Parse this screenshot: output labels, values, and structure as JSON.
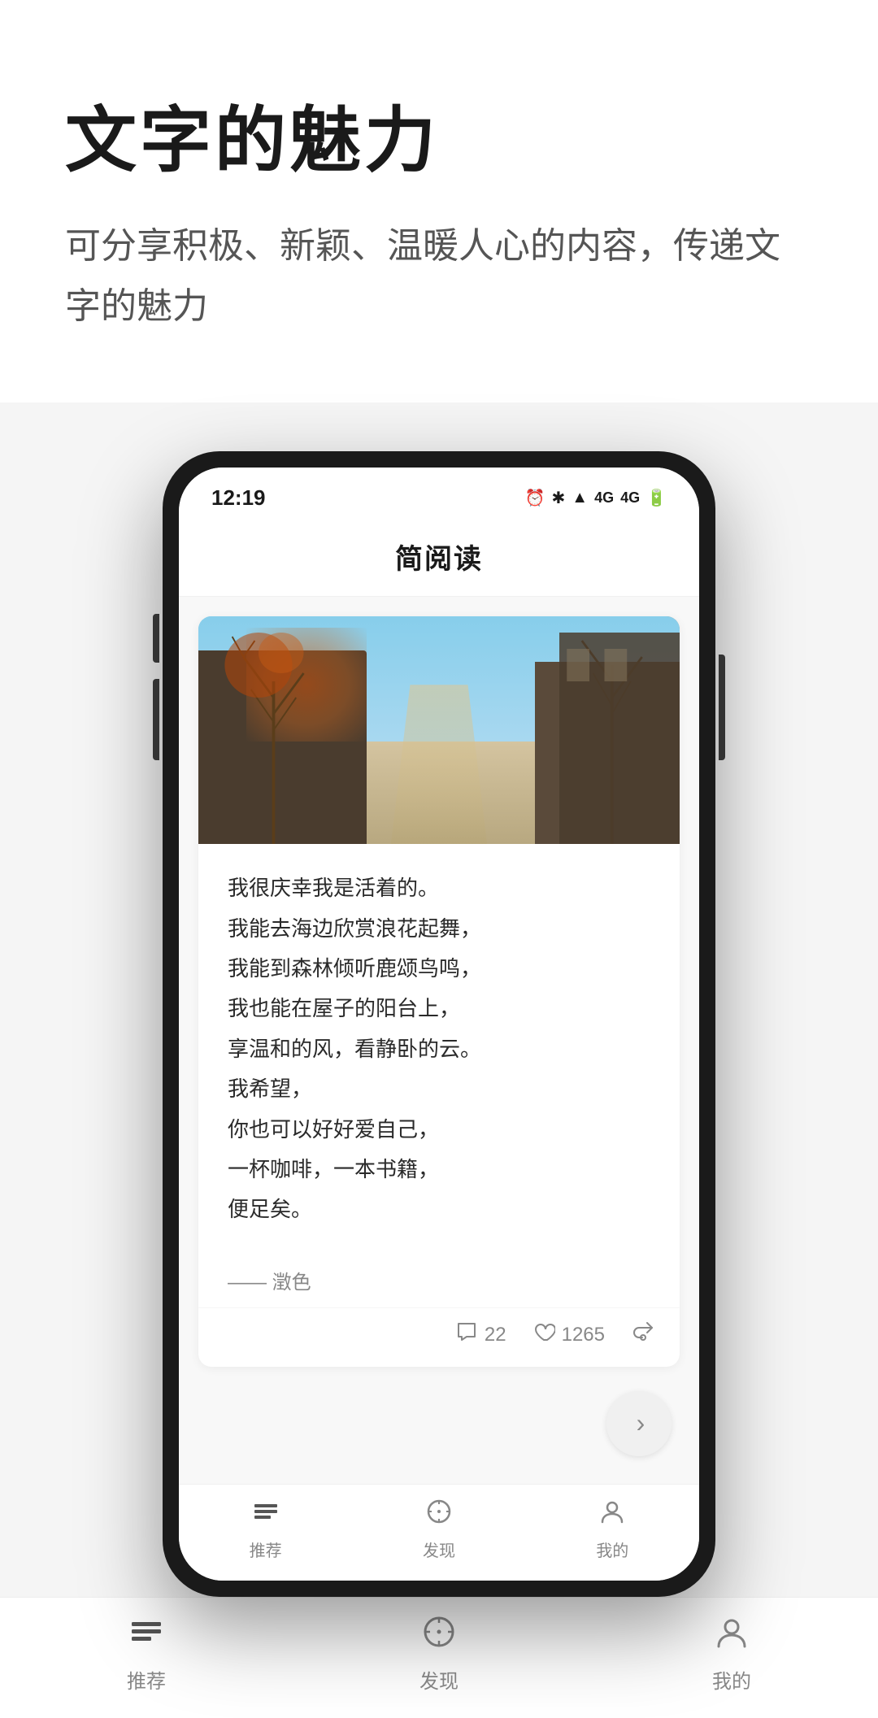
{
  "page": {
    "background": "#f5f5f5"
  },
  "header": {
    "title": "文字的魅力",
    "subtitle": "可分享积极、新颖、温暖人心的内容，传递文字的魅力"
  },
  "phone": {
    "status_bar": {
      "time": "12:19",
      "network_icon": "N",
      "icons": "⏰ ✱ ⚡ ▲ 4G 4G 🔋"
    },
    "app_title": "简阅读",
    "article": {
      "text_lines": [
        "我很庆幸我是活着的。",
        "我能去海边欣赏浪花起舞，",
        "我能到森林倾听鹿颂鸟鸣，",
        "我也能在屋子的阳台上，",
        "享温和的风，看静卧的云。",
        "我希望，",
        "你也可以好好爱自己，",
        "一杯咖啡，一本书籍，",
        "便足矣。"
      ],
      "author": "—— 澂色",
      "comment_icon": "💬",
      "comment_count": "22",
      "like_icon": "♡",
      "like_count": "1265",
      "share_icon": "⎋"
    },
    "nav": {
      "items": [
        {
          "icon": "📺",
          "label": "推荐"
        },
        {
          "icon": "🧭",
          "label": "发现"
        },
        {
          "icon": "👤",
          "label": "我的"
        }
      ]
    }
  },
  "bottom_tabs": [
    {
      "label": "推荐",
      "icon": "display"
    },
    {
      "label": "发现",
      "icon": "compass"
    },
    {
      "label": "我的",
      "icon": "person"
    }
  ]
}
